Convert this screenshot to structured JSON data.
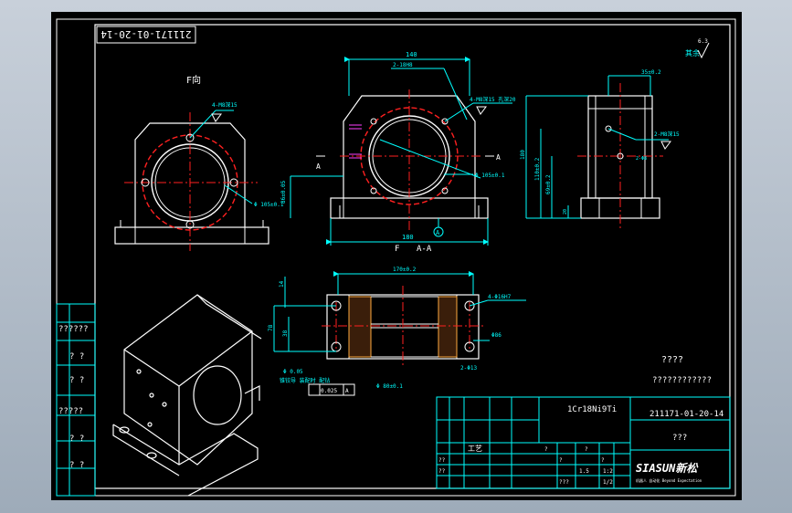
{
  "drawing": {
    "drawing_number": "211171-01-20-14",
    "drawing_number_title_block": "211171-01-20-14",
    "material": "1Cr18Ni9Ti",
    "unknown_box": "???",
    "question_mark_1": "????",
    "question_mark_2": "????????????",
    "roughness_note": "其余",
    "roughness_value": "6.3",
    "title_block_text_a": "??",
    "title_block_text_b": "?",
    "marking_a": "??????",
    "marking_b": "?????",
    "note_top_view": "F向",
    "section_label": "A-A",
    "view_arrow_label": "F",
    "section_arrow_a": "A",
    "datum_a": "A"
  },
  "dimensions": {
    "width_top": "140",
    "width_bottom": "180",
    "hole_top": "2-18H8",
    "holes_right": "4-M8深15 孔深20",
    "dia_right": "Φ 105±0.1",
    "height_left": "86±0.05",
    "dia_left_view": "Φ 105±0.1",
    "holes_left_view": "4-M8深15",
    "right_top_dim": "35±0.2",
    "right_height": "180",
    "right_inner": "110±0.2",
    "right_inner2": "69±0.2",
    "right_small": "20",
    "right_holes": "2-M8深15",
    "right_holes2": "2-Φ8",
    "section_width": "170±0.2",
    "section_left": "14",
    "section_hole": "4-Φ16H7",
    "section_dim1": "78",
    "section_dim2": "38",
    "section_dim3": "Φ86",
    "section_bottom_hole": "2-Φ13",
    "section_note_left": "Φ 0.05",
    "section_note_left2": "锥铰导 装配时 配钻",
    "tolerance_frame": "0.025",
    "tolerance_datum": "A",
    "bottom_dim": "Φ 80±0.1"
  },
  "title_block": {
    "cells": [
      "??",
      "??",
      "?",
      "?",
      "?",
      "?",
      "1.5",
      "1:2",
      "???",
      "1/2"
    ],
    "company_name": "SIASUN新松",
    "company_sub": "机器人 自动化 Beyond Expectation",
    "label_process": "工艺"
  },
  "left_table": {
    "rows": [
      "??????",
      "? ?",
      "? ?",
      "?????",
      "? ?",
      "? ?"
    ]
  }
}
